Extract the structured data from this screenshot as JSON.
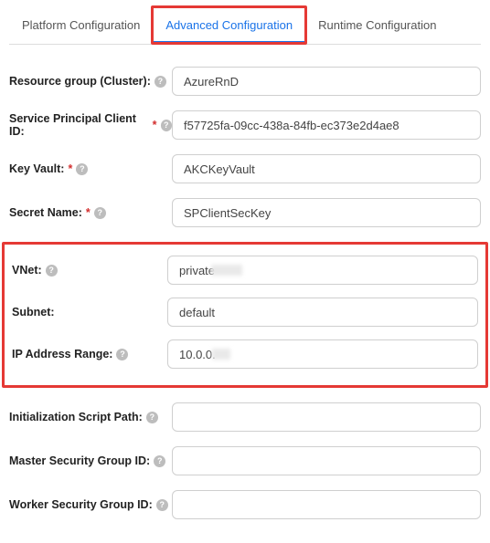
{
  "tabs": {
    "platform": "Platform Configuration",
    "advanced": "Advanced Configuration",
    "runtime": "Runtime Configuration",
    "active": "advanced"
  },
  "fields": {
    "resource_group": {
      "label": "Resource group (Cluster):",
      "value": "AzureRnD"
    },
    "spn_client_id": {
      "label": "Service Principal Client ID:",
      "value": "f57725fa-09cc-438a-84fb-ec373e2d4ae8"
    },
    "key_vault": {
      "label": "Key Vault:",
      "value": "AKCKeyVault"
    },
    "secret_name": {
      "label": "Secret Name:",
      "value": "SPClientSecKey"
    },
    "vnet": {
      "label": "VNet:",
      "value": "private"
    },
    "subnet": {
      "label": "Subnet:",
      "value": "default"
    },
    "ip_range": {
      "label": "IP Address Range:",
      "value": "10.0.0."
    },
    "init_script": {
      "label": "Initialization Script Path:",
      "value": ""
    },
    "master_sg": {
      "label": "Master Security Group ID:",
      "value": ""
    },
    "worker_sg": {
      "label": "Worker Security Group ID:",
      "value": ""
    }
  },
  "required_marker": "*",
  "help_glyph": "?"
}
